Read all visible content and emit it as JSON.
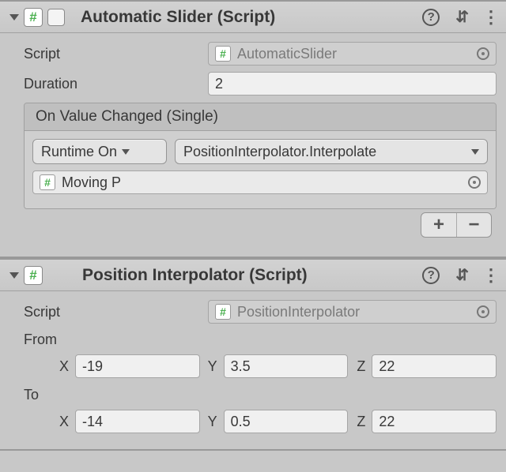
{
  "components": [
    {
      "title": "Automatic Slider (Script)",
      "script_label": "Script",
      "script_value": "AutomaticSlider",
      "fields": [
        {
          "label": "Duration",
          "value": "2",
          "type": "float"
        }
      ],
      "event": {
        "header": "On Value Changed (Single)",
        "runtime_mode": "Runtime On",
        "method": "PositionInterpolator.Interpolate",
        "target": "Moving P"
      }
    },
    {
      "title": "Position Interpolator (Script)",
      "script_label": "Script",
      "script_value": "PositionInterpolator",
      "vectors": [
        {
          "label": "From",
          "x": "-19",
          "y": "3.5",
          "z": "22"
        },
        {
          "label": "To",
          "x": "-14",
          "y": "0.5",
          "z": "22"
        }
      ]
    }
  ],
  "glyphs": {
    "help": "?",
    "preset": "⇄",
    "kebab": "⋮",
    "plus": "+",
    "minus": "−",
    "hash": "#"
  }
}
